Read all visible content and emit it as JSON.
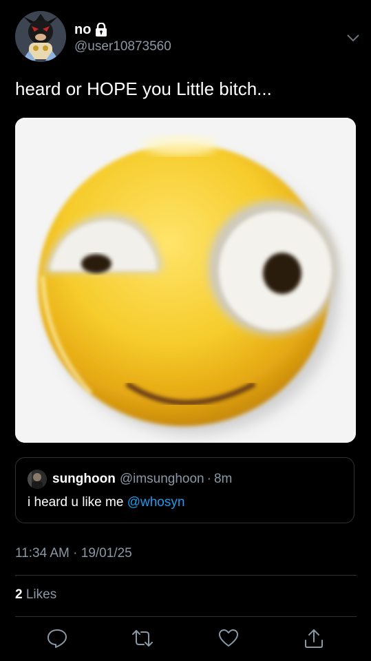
{
  "author": {
    "display_name": "no",
    "handle": "@user10873560",
    "locked_icon": "lock-icon"
  },
  "tweet": {
    "text": "heard or HOPE you Little bitch..."
  },
  "media": {
    "icon": "squinting-smiley-emoji-image"
  },
  "quote": {
    "name": "sunghoon",
    "handle": "@imsunghoon",
    "separator": "·",
    "time": "8m",
    "text_before": "i heard u like me ",
    "mention": "@whosyn"
  },
  "meta": {
    "time": "11:34 AM",
    "separator": "·",
    "date": "19/01/25"
  },
  "likes": {
    "count": "2",
    "label": "Likes"
  },
  "actions": {
    "reply_icon": "reply-icon",
    "retweet_icon": "retweet-icon",
    "like_icon": "heart-icon",
    "share_icon": "share-icon"
  },
  "colors": {
    "background": "#000000",
    "text": "#ffffff",
    "secondary": "#8b98a5",
    "accent": "#1d9bf0",
    "divider": "#2f3336"
  }
}
